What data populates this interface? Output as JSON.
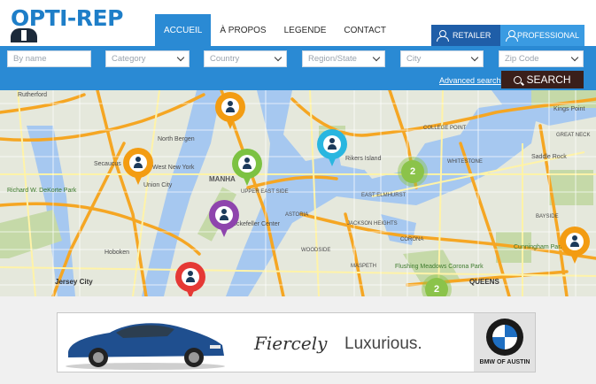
{
  "brand": {
    "logo_text": "OPTI-REP"
  },
  "nav": {
    "items": [
      {
        "label": "ACCUEIL",
        "active": true
      },
      {
        "label": "À PROPOS",
        "active": false
      },
      {
        "label": "LEGENDE",
        "active": false
      },
      {
        "label": "CONTACT",
        "active": false
      }
    ]
  },
  "role_tabs": {
    "retailer": {
      "label": "RETAILER",
      "color": "#1f5ea8"
    },
    "professional": {
      "label": "PROFESSIONAL",
      "color": "#3a9be2"
    }
  },
  "search": {
    "name_placeholder": "By name",
    "category_placeholder": "Category",
    "country_placeholder": "Country",
    "region_placeholder": "Region/State",
    "city_placeholder": "City",
    "zip_placeholder": "Zip Code",
    "advanced_label": "Advanced search",
    "button_label": "SEARCH",
    "bar_color": "#2a8ad4"
  },
  "map": {
    "labels": {
      "rutherford": "Rutherford",
      "north_bergen": "North Bergen",
      "secaucus": "Secaucus",
      "west_ny": "West New York",
      "union_city": "Union City",
      "richard": "Richard W. DeKorte Park",
      "hoboken": "Hoboken",
      "jersey_city": "Jersey City",
      "manhattan": "MANHA",
      "upper_east": "UPPER EAST SIDE",
      "rockefeller": "Rockefeller Center",
      "rikers": "Rikers Island",
      "east_elmhurst": "EAST ELMHURST",
      "astoria": "ASTORIA",
      "jackson_hts": "JACKSON HEIGHTS",
      "corona": "CORONA",
      "flushing": "Flushing Meadows Corona Park",
      "queens": "QUEENS",
      "whitestone": "WHITESTONE",
      "bayside": "BAYSIDE",
      "kings_point": "Kings Point",
      "great_neck": "GREAT NECK",
      "saddle_rock": "Saddle Rock",
      "cunningham": "Cunningham Park",
      "maspeth": "MASPETH",
      "college_pt": "COLLEGE POINT",
      "woodside": "WOODSIDE"
    },
    "pins": [
      {
        "name": "pin-orange-top",
        "color": "#f39c12"
      },
      {
        "name": "pin-orange-left",
        "color": "#f39c12"
      },
      {
        "name": "pin-green",
        "color": "#7cc242"
      },
      {
        "name": "pin-cyan",
        "color": "#29b6e0"
      },
      {
        "name": "pin-purple",
        "color": "#8e44ad"
      },
      {
        "name": "pin-red",
        "color": "#e53935"
      },
      {
        "name": "pin-orange-right",
        "color": "#f39c12"
      }
    ],
    "clusters": [
      {
        "count": "2"
      },
      {
        "count": "2"
      }
    ]
  },
  "ad": {
    "tagline_1": "Fiercely",
    "tagline_2": "Luxurious.",
    "brand_text": "BMW OF AUSTIN"
  }
}
